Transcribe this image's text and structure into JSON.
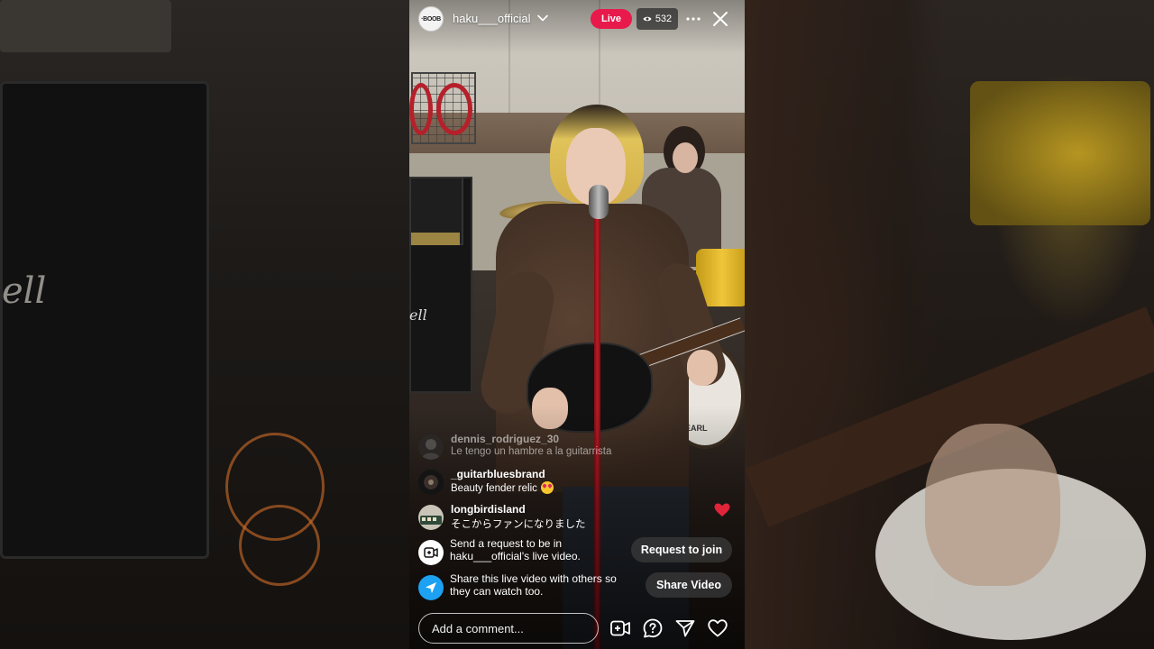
{
  "header": {
    "avatar_text": "·BOOB",
    "username": "haku___official",
    "live_label": "Live",
    "viewer_count": "532"
  },
  "comments": [
    {
      "user": "dennis_rodriguez_30",
      "text": "Le tengo un hambre a la guitarrista",
      "faded": true
    },
    {
      "user": "_guitarbluesbrand",
      "text": "Beauty fender relic",
      "emoji": "heart-eyes"
    },
    {
      "user": "longbirdisland",
      "text": "そこからファンになりました"
    }
  ],
  "system_messages": {
    "request": {
      "text": "Send a request to be in haku___official's live video.",
      "button": "Request to join"
    },
    "share": {
      "text": "Share this live video with others so they can watch too.",
      "button": "Share Video"
    }
  },
  "bottom_bar": {
    "comment_placeholder": "Add a comment...",
    "icons": [
      "add-guest-icon",
      "question-icon",
      "send-icon",
      "heart-icon"
    ]
  },
  "colors": {
    "live_badge": "#e8194b",
    "share_icon_bg": "#1da1f2",
    "floating_heart": "#e0243a"
  },
  "background": {
    "amp_brand_fragment": "ell"
  }
}
